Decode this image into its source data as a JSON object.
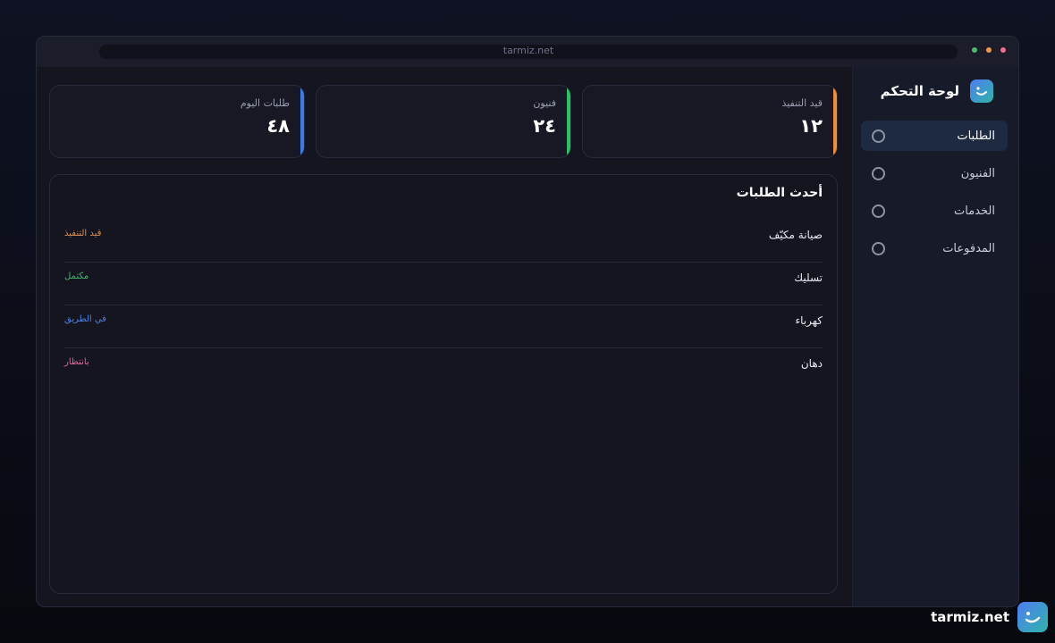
{
  "window": {
    "url": "tarmiz.net",
    "dots": [
      {
        "name": "close",
        "color": "#ef6f91"
      },
      {
        "name": "minimize",
        "color": "#f29a49"
      },
      {
        "name": "maximize",
        "color": "#3fc26b"
      }
    ]
  },
  "sidebar": {
    "title": "لوحة التحكم",
    "logo_icon": "smile-logo-icon",
    "items": [
      {
        "label": "الطلبات",
        "active": true
      },
      {
        "label": "الفنيون",
        "active": false
      },
      {
        "label": "الخدمات",
        "active": false
      },
      {
        "label": "المدفوعات",
        "active": false
      }
    ]
  },
  "stats": [
    {
      "label": "قيد التنفيذ",
      "value": "١٢",
      "accent": "#f28c3b"
    },
    {
      "label": "فنيون",
      "value": "٢٤",
      "accent": "#2fbf63"
    },
    {
      "label": "طلبات اليوم",
      "value": "٤٨",
      "accent": "#3b7ae8"
    }
  ],
  "orders_panel": {
    "title": "أحدث الطلبات",
    "rows": [
      {
        "service": "صيانة مكيّف",
        "status": "قيد التنفيذ",
        "status_color": "#e08d4d"
      },
      {
        "service": "تسليك",
        "status": "مكتمل",
        "status_color": "#3fb96a"
      },
      {
        "service": "كهرباء",
        "status": "في الطريق",
        "status_color": "#4f82e8"
      },
      {
        "service": "دهان",
        "status": "بانتظار",
        "status_color": "#e3679a"
      }
    ]
  },
  "footer": {
    "brand": "tarmiz.net"
  }
}
